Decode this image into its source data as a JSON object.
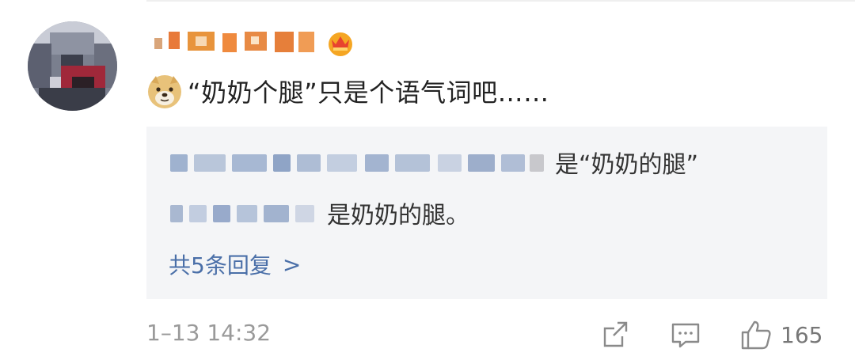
{
  "comment": {
    "text": "“奶奶个腿”只是个语气词吧……",
    "timestamp": "1–13 14:32",
    "like_count": "165"
  },
  "replies": [
    {
      "text": "是“奶奶的腿”"
    },
    {
      "text": "是奶奶的腿。"
    }
  ],
  "more_replies_label": "共5条回复",
  "more_replies_chevron": ">",
  "icons": {
    "avatar": "blurred-avatar",
    "crown": "crown-icon",
    "emoji": "doge-icon",
    "share": "share-icon",
    "comment": "comment-icon",
    "like": "thumbs-up-icon"
  },
  "colors": {
    "link": "#4a6fa8",
    "muted": "#9a9a9a",
    "reply_background": "#f4f5f7"
  }
}
